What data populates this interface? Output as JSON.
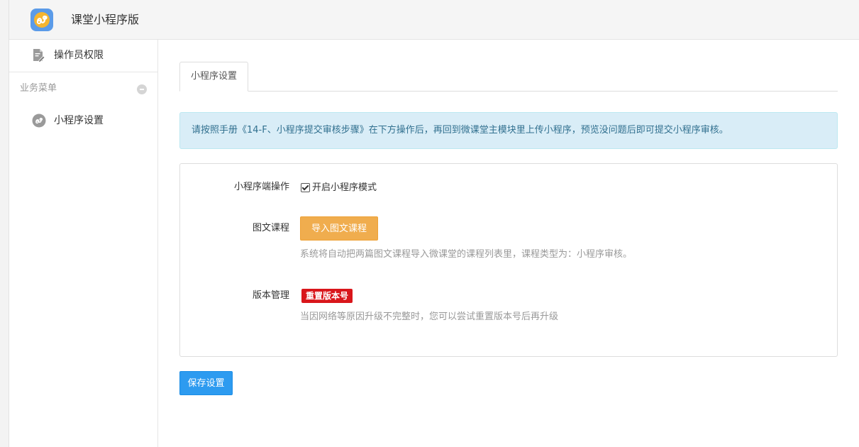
{
  "header": {
    "app_title": "课堂小程序版",
    "logo_icon": "miniprogram-logo-icon",
    "logo_color": "#5b9be8"
  },
  "sidebar": {
    "top_item": {
      "label": "操作员权限",
      "icon": "document-edit-icon"
    },
    "group": {
      "label": "业务菜单",
      "collapse_icon": "collapse-icon"
    },
    "items": [
      {
        "label": "小程序设置",
        "icon": "miniprogram-icon"
      }
    ]
  },
  "main": {
    "tabs": [
      {
        "label": "小程序设置",
        "active": true
      }
    ],
    "alert_text": "请按照手册《14-F、小程序提交审核步骤》在下方操作后，再回到微课堂主模块里上传小程序，预览没问题后即可提交小程序审核。",
    "form": {
      "rows": [
        {
          "label": "小程序端操作",
          "checkbox_label": "开启小程序模式",
          "checked": true
        },
        {
          "label": "图文课程",
          "button_label": "导入图文课程",
          "help": "系统将自动把两篇图文课程导入微课堂的课程列表里，课程类型为：小程序审核。"
        },
        {
          "label": "版本管理",
          "button_label": "重置版本号",
          "help": "当因网络等原因升级不完整时，您可以尝试重置版本号后再升级"
        }
      ]
    },
    "save_label": "保存设置"
  },
  "colors": {
    "alert_bg": "#d9edf7",
    "alert_text": "#31708f",
    "warning": "#f0ad4e",
    "danger": "#d9161b",
    "primary": "#2d9bf0"
  }
}
